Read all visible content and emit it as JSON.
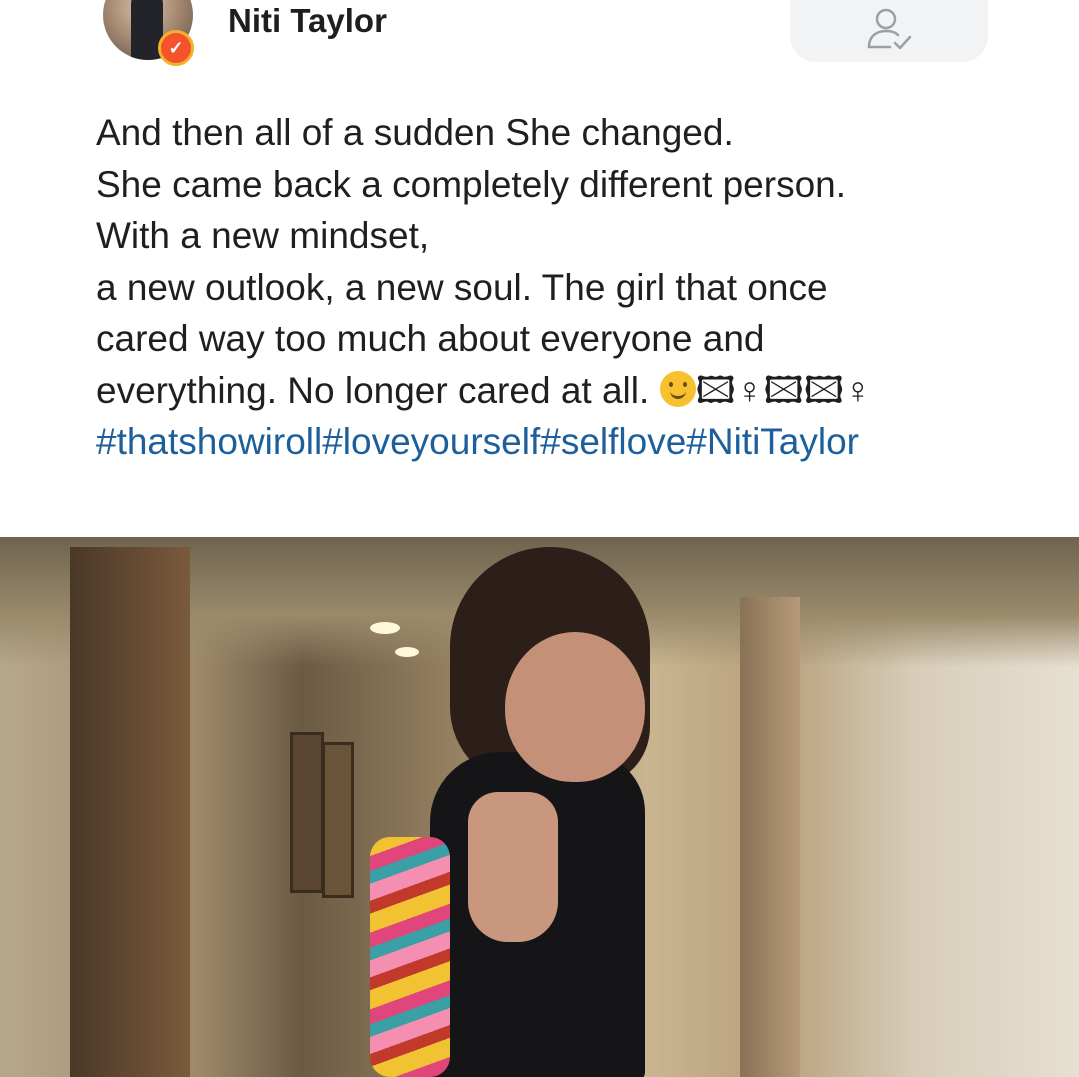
{
  "post": {
    "author_name": "Niti Taylor",
    "text_lines": [
      "And then all of a sudden She changed.",
      "She came back a completely different person.",
      "With a new mindset,",
      "a new outlook, a new soul. The girl that once",
      "cared way too much about everyone and",
      "everything. No longer cared at all."
    ],
    "emoji_trail": "🖾♀🖾🖾♀",
    "hashtags": "#thatshowiroll#loveyourself#selflove#NitiTaylor"
  },
  "icons": {
    "verified_badge": "verified-badge-icon",
    "follow": "person-check-icon",
    "smile_emoji": "smiling-face-emoji"
  },
  "colors": {
    "hashtag": "#1c5f9a",
    "badge": "#f3542b",
    "follow_button_bg": "#f2f3f4"
  }
}
